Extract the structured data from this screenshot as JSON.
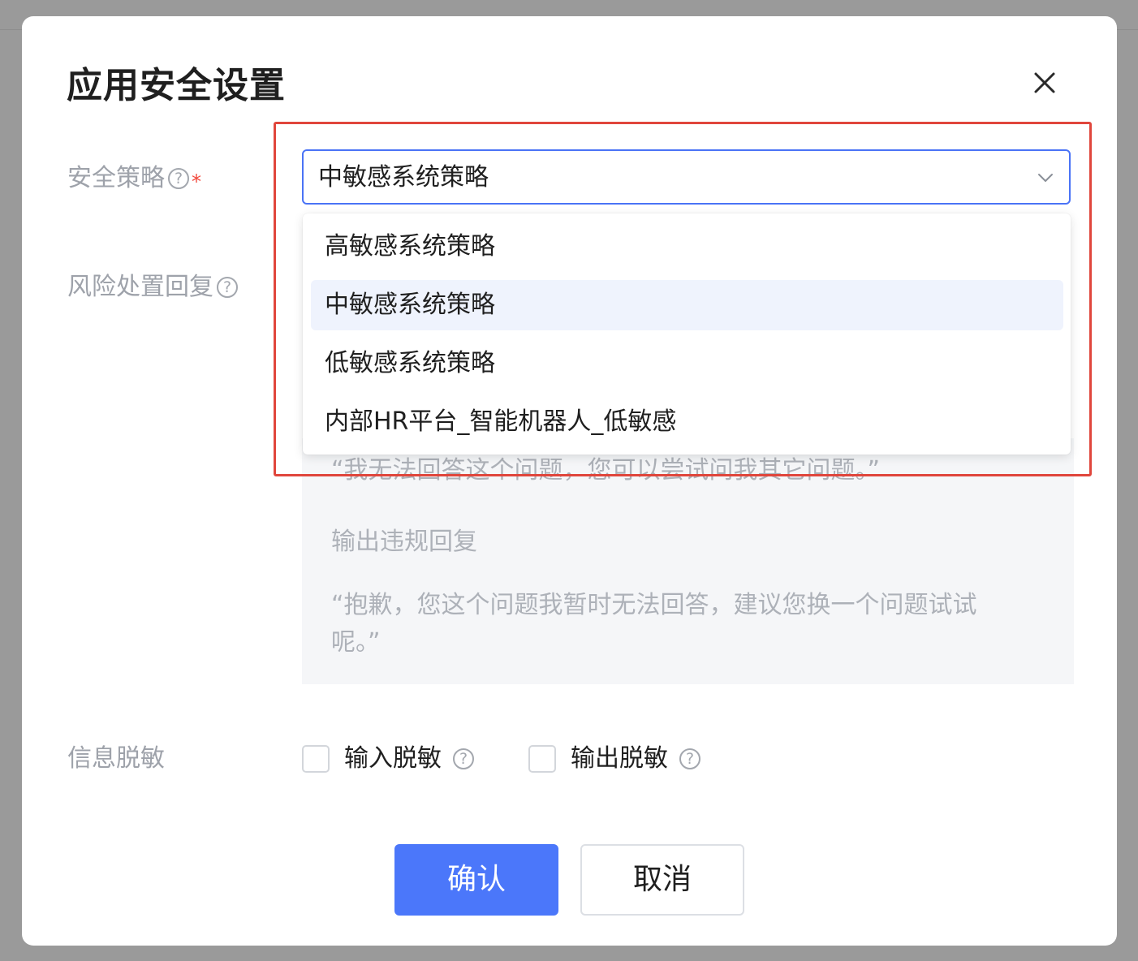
{
  "dialog": {
    "title": "应用安全设置"
  },
  "form": {
    "security_policy": {
      "label": "安全策略",
      "help_icon": "?",
      "required_mark": "*",
      "selected_value": "中敏感系统策略"
    },
    "risk_response": {
      "label": "风险处置回复",
      "help_icon": "?",
      "input_violation_text": "“我无法回答这个问题，您可以尝试问我其它问题。”",
      "output_violation_heading": "输出违规回复",
      "output_violation_text": "“抱歉，您这个问题我暂时无法回答，建议您换一个问题试试呢。”"
    },
    "desensitization": {
      "label": "信息脱敏",
      "options": [
        {
          "label": "输入脱敏",
          "help_icon": "?",
          "checked": false
        },
        {
          "label": "输出脱敏",
          "help_icon": "?",
          "checked": false
        }
      ]
    }
  },
  "dropdown": {
    "options": [
      {
        "label": "高敏感系统策略",
        "selected": false
      },
      {
        "label": "中敏感系统策略",
        "selected": true
      },
      {
        "label": "低敏感系统策略",
        "selected": false
      },
      {
        "label": "内部HR平台_智能机器人_低敏感",
        "selected": false
      }
    ]
  },
  "buttons": {
    "confirm": "确认",
    "cancel": "取消"
  },
  "colors": {
    "primary": "#4b77fa",
    "focus_border": "#4a73f6",
    "highlight_outline": "#e0463c",
    "required": "#f2473b",
    "selected_option_bg": "#eff3fd"
  },
  "icons": {
    "close": "close-icon",
    "chevron": "chevron-down-icon",
    "help": "question-circle-icon"
  }
}
